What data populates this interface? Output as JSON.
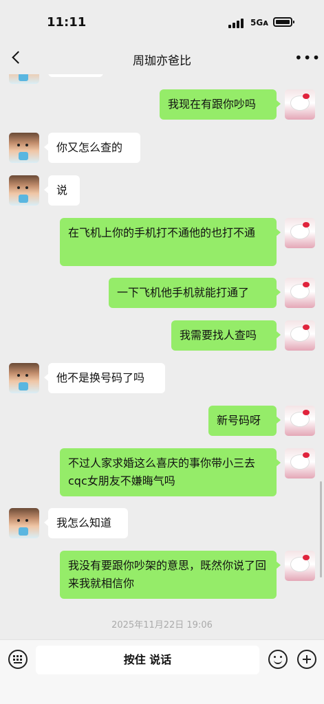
{
  "status_bar": {
    "time": "11:11",
    "network": "5Gᴀ"
  },
  "header": {
    "title": "周珈亦爸比",
    "more": "•••"
  },
  "messages": [
    {
      "side": "right",
      "text": "我现在有跟你吵吗"
    },
    {
      "side": "left",
      "text": "你又怎么查的"
    },
    {
      "side": "left",
      "text": "说"
    },
    {
      "side": "right",
      "text": "在飞机上你的手机打不通他的也打不通"
    },
    {
      "side": "right",
      "text": "一下飞机他手机就能打通了"
    },
    {
      "side": "right",
      "text": "我需要找人查吗"
    },
    {
      "side": "left",
      "text": "他不是换号码了吗"
    },
    {
      "side": "right",
      "text": "新号码呀"
    },
    {
      "side": "right",
      "text": "不过人家求婚这么喜庆的事你带小三去cqc女朋友不嫌晦气吗"
    },
    {
      "side": "left",
      "text": "我怎么知道"
    },
    {
      "side": "right",
      "text": "我没有要跟你吵架的意思，既然你说了回来我就相信你"
    }
  ],
  "timestamp": "2025年11月22日 19:06",
  "input_bar": {
    "voice_label": "按住 说话"
  },
  "icons": {
    "back": "back-arrow-icon",
    "more": "more-icon",
    "keyboard": "keyboard-icon",
    "emoji": "emoji-icon",
    "plus": "plus-icon"
  },
  "colors": {
    "sent_bubble": "#95ec69",
    "received_bubble": "#ffffff",
    "background": "#ededed"
  }
}
